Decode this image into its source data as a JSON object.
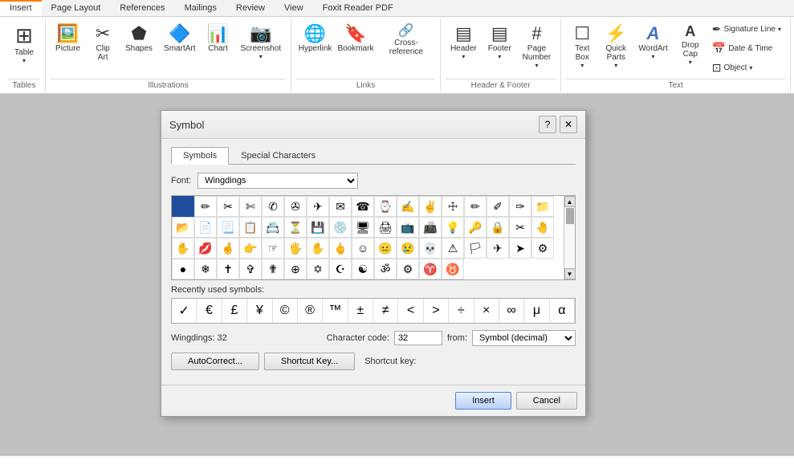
{
  "ribbon": {
    "tabs": [
      {
        "label": "Insert",
        "active": true
      },
      {
        "label": "Page Layout",
        "active": false
      },
      {
        "label": "References",
        "active": false
      },
      {
        "label": "Mailings",
        "active": false
      },
      {
        "label": "Review",
        "active": false
      },
      {
        "label": "View",
        "active": false
      },
      {
        "label": "Foxit Reader PDF",
        "active": false
      }
    ],
    "groups": {
      "tables": {
        "label": "Tables",
        "items": [
          {
            "icon": "⊞",
            "label": "Table",
            "dropdown": true
          }
        ]
      },
      "illustrations": {
        "label": "Illustrations",
        "items": [
          {
            "icon": "🖼",
            "label": "Picture"
          },
          {
            "icon": "✂",
            "label": "Clip\nArt"
          },
          {
            "icon": "⬟",
            "label": "Shapes"
          },
          {
            "icon": "🔷",
            "label": "SmartArt"
          },
          {
            "icon": "📊",
            "label": "Chart"
          },
          {
            "icon": "📷",
            "label": "Screenshot",
            "dropdown": true
          }
        ]
      },
      "links": {
        "label": "Links",
        "items": [
          {
            "icon": "🌐",
            "label": "Hyperlink"
          },
          {
            "icon": "🔖",
            "label": "Bookmark"
          },
          {
            "icon": "🔗",
            "label": "Cross-reference"
          }
        ]
      },
      "header_footer": {
        "label": "Header & Footer",
        "items": [
          {
            "icon": "▤",
            "label": "Header",
            "dropdown": true
          },
          {
            "icon": "▤",
            "label": "Footer",
            "dropdown": true
          },
          {
            "icon": "#",
            "label": "Page\nNumber",
            "dropdown": true
          }
        ]
      },
      "text": {
        "label": "Text",
        "items": [
          {
            "icon": "☐",
            "label": "Text\nBox",
            "dropdown": true
          },
          {
            "icon": "⚡",
            "label": "Quick\nParts",
            "dropdown": true
          },
          {
            "icon": "A",
            "label": "WordArt",
            "dropdown": true
          },
          {
            "icon": "A",
            "label": "Drop\nCap",
            "dropdown": true
          }
        ],
        "small_items": [
          {
            "icon": "✒",
            "label": "Signature Line",
            "dropdown": true
          },
          {
            "icon": "📅",
            "label": "Date & Time"
          },
          {
            "icon": "⊡",
            "label": "Object",
            "dropdown": true
          }
        ]
      }
    }
  },
  "dialog": {
    "title": "Symbol",
    "tabs": [
      {
        "label": "Symbols",
        "active": true
      },
      {
        "label": "Special Characters",
        "active": false
      }
    ],
    "font_label": "Font:",
    "font_value": "Wingdings",
    "symbols_row1": [
      "■",
      "✂",
      "✄",
      "✁",
      "✆",
      "✇",
      "✈",
      "✉",
      "☎",
      "✍",
      "✌",
      "✋",
      "✊",
      "✏",
      "✐",
      "✑",
      "✒"
    ],
    "symbols_row2": [
      "📁",
      "📂",
      "📄",
      "📃",
      "📋",
      "📇",
      "⏳",
      "💽",
      "💾",
      "🖥",
      "📺",
      "🖨",
      "📠",
      "💡",
      "🔑",
      "🔒",
      "🔓"
    ],
    "symbols_row3": [
      "✂",
      "🤚",
      "🤙",
      "💋",
      "🤞",
      "👉",
      "☞",
      "🖐",
      "🤜",
      "🖕",
      "☺",
      "😐",
      "😢",
      "💀",
      "⚠",
      "🏳",
      "🏁"
    ],
    "symbols_row4": [
      "✈",
      "✈",
      "⚙",
      "●",
      "❄",
      "✝",
      "✞",
      "✟",
      "⊕",
      "✡",
      "☪",
      "☯",
      "ॐ",
      "⚙",
      "♈",
      "♉"
    ],
    "recently_used_label": "Recently used symbols:",
    "recently_used": [
      "✓",
      "€",
      "£",
      "¥",
      "©",
      "®",
      "™",
      "±",
      "≠",
      "<",
      ">",
      "÷",
      "×",
      "∞",
      "μ",
      "α"
    ],
    "wingdings_info": "Wingdings: 32",
    "character_code_label": "Character code:",
    "character_code_value": "32",
    "from_label": "from:",
    "from_value": "Symbol (decimal)",
    "shortcut_key_label": "Shortcut key:",
    "buttons": {
      "autocorrect": "AutoCorrect...",
      "shortcut_key": "Shortcut Key...",
      "insert": "Insert",
      "cancel": "Cancel"
    }
  }
}
